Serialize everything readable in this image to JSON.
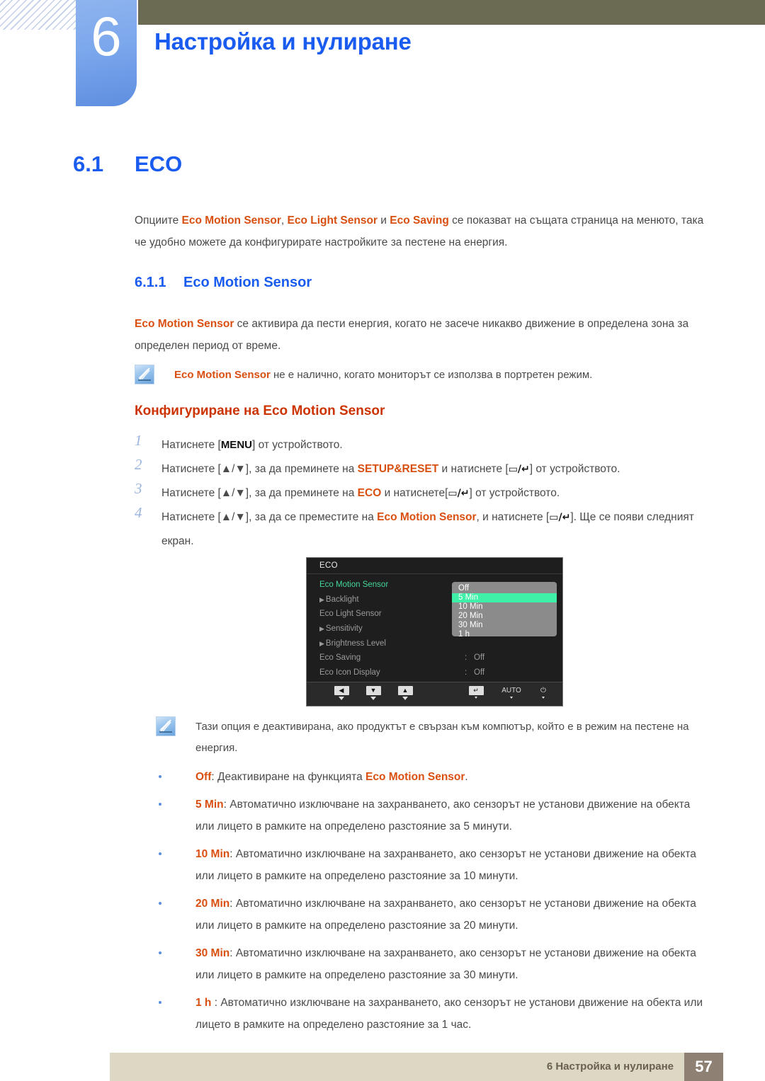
{
  "header": {
    "chapter_number": "6",
    "chapter_title": "Настройка и нулиране"
  },
  "headings": {
    "h1_number": "6.1",
    "h1_title": "ECO",
    "h2_number": "6.1.1",
    "h2_title": "Eco Motion Sensor",
    "h3_title": "Конфигуриране на Eco Motion Sensor"
  },
  "intro": {
    "t1": "Опциите ",
    "b1": "Eco Motion Sensor",
    "t2": ", ",
    "b2": "Eco Light Sensor",
    "t3": " и ",
    "b3": "Eco Saving",
    "t4": " се показват на същата страница на менюто, така че удобно можете да конфигурирате настройките за пестене на енергия."
  },
  "description": {
    "b1": "Eco Motion Sensor",
    "t1": " се активира да пести енергия, когато не засече никакво движение в определена зона за определен период от време."
  },
  "note1": {
    "b1": "Eco Motion Sensor",
    "t1": " не е налично, когато мониторът се използва в портретен режим."
  },
  "note2": {
    "text": "Тази опция е деактивирана, ако продуктът е свързан към компютър, който е в режим на пестене на енергия."
  },
  "steps": [
    {
      "num": "1",
      "pre": "Натиснете [",
      "key": "MENU",
      "post": "] от устройството."
    },
    {
      "num": "2",
      "pre": "Натиснете [▲/▼], за да преминете на ",
      "bold": "SETUP&RESET",
      "mid": " и натиснете [",
      "glyph": "▭/↵",
      "post": "] от устройството."
    },
    {
      "num": "3",
      "pre": "Натиснете [▲/▼], за да преминете на ",
      "bold": "ECO",
      "mid": " и натиснете[",
      "glyph": "▭/↵",
      "post": "] от устройството."
    },
    {
      "num": "4",
      "pre": "Натиснете [▲/▼], за да се преместите на ",
      "bold": "Eco Motion Sensor",
      "mid": ", и натиснете [",
      "glyph": "▭/↵",
      "post": "]. Ще се появи следният екран."
    }
  ],
  "osd": {
    "title": "ECO",
    "rows": [
      {
        "label": "Eco Motion Sensor",
        "arrow": false,
        "selected": true,
        "colon": ":",
        "value": ""
      },
      {
        "label": "Backlight",
        "arrow": true,
        "selected": false,
        "colon": ":",
        "value": ""
      },
      {
        "label": "Eco Light Sensor",
        "arrow": false,
        "selected": false,
        "colon": ":",
        "value": ""
      },
      {
        "label": "Sensitivity",
        "arrow": true,
        "selected": false,
        "colon": "",
        "value": ""
      },
      {
        "label": "Brightness Level",
        "arrow": true,
        "selected": false,
        "colon": "",
        "value": ""
      },
      {
        "label": "Eco Saving",
        "arrow": false,
        "selected": false,
        "colon": ":",
        "value": "Off"
      },
      {
        "label": "Eco Icon Display",
        "arrow": false,
        "selected": false,
        "colon": ":",
        "value": "Off"
      }
    ],
    "dropdown": {
      "options": [
        "Off",
        "5 Min",
        "10 Min",
        "20 Min",
        "30 Min",
        "1 h"
      ],
      "highlighted": "5 Min",
      "highlight_color": "#3ff0a8",
      "background_color": "#8b8b8b"
    },
    "buttons": [
      {
        "name": "left",
        "glyph": "◀",
        "type": "box"
      },
      {
        "name": "down",
        "glyph": "▼",
        "type": "box"
      },
      {
        "name": "up",
        "glyph": "▲",
        "type": "box"
      },
      {
        "name": "enter",
        "glyph": "↵",
        "type": "box"
      },
      {
        "name": "auto",
        "glyph": "AUTO",
        "type": "text"
      },
      {
        "name": "power",
        "glyph": "⏻",
        "type": "text"
      }
    ]
  },
  "bullets": [
    {
      "term": "Off",
      "sep": ": ",
      "text_pre": "Деактивиране на функцията ",
      "term2": "Eco Motion Sensor",
      "text_post": "."
    },
    {
      "term": "5 Min",
      "sep": ": ",
      "text_pre": "Автоматично изключване на захранването, ако сензорът не установи движение на обекта или лицето в рамките на определено разстояние за 5 минути.",
      "term2": "",
      "text_post": ""
    },
    {
      "term": "10 Min",
      "sep": ": ",
      "text_pre": "Автоматично изключване на захранването, ако сензорът не установи движение на обекта или лицето в рамките на определено разстояние за 10 минути.",
      "term2": "",
      "text_post": ""
    },
    {
      "term": "20 Min",
      "sep": ": ",
      "text_pre": "Автоматично изключване на захранването, ако сензорът не установи движение на обекта или лицето в рамките на определено разстояние за 20 минути.",
      "term2": "",
      "text_post": ""
    },
    {
      "term": "30 Min",
      "sep": ": ",
      "text_pre": "Автоматично изключване на захранването, ако сензорът не установи движение на обекта или лицето в рамките на определено разстояние за 30 минути.",
      "term2": "",
      "text_post": ""
    },
    {
      "term": "1 h",
      "sep": " : ",
      "text_pre": "Автоматично изключване на захранването, ако сензорът не установи движение на обекта или лицето в рамките на определено разстояние за 1 час.",
      "term2": "",
      "text_post": ""
    }
  ],
  "footer": {
    "text": "6 Настройка и нулиране",
    "page_number": "57"
  },
  "colors": {
    "heading_blue": "#1b5cf0",
    "accent_orange": "#d94f10",
    "olive": "#6b6a52",
    "tab_blue": "#7ba7ec",
    "footer_bar": "#ddd8c4",
    "footer_page": "#8e8174",
    "osd_bg": "#1e1e1e",
    "osd_selected": "#45d69a"
  }
}
